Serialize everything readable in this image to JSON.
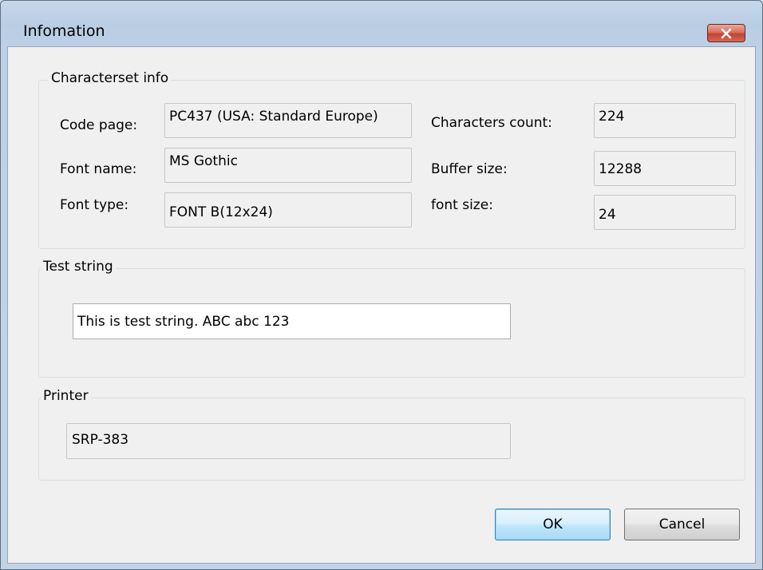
{
  "window": {
    "title": "Infomation",
    "close_icon": "close-x-icon"
  },
  "charset": {
    "legend": "Characterset info",
    "code_page_label": "Code page:",
    "code_page_value": "PC437 (USA: Standard Europe)",
    "font_name_label": "Font name:",
    "font_name_value": "MS Gothic",
    "font_type_label": "Font type:",
    "font_type_value": "FONT B(12x24)",
    "characters_count_label": "Characters count:",
    "characters_count_value": "224",
    "buffer_size_label": "Buffer size:",
    "buffer_size_value": "12288",
    "font_size_label": "font size:",
    "font_size_value": "24"
  },
  "test": {
    "legend": "Test string",
    "value": "This is test string. ABC abc 123"
  },
  "printer": {
    "legend": "Printer",
    "value": "SRP-383"
  },
  "buttons": {
    "ok": "OK",
    "cancel": "Cancel"
  },
  "colors": {
    "close_button": "#c4432f",
    "default_button_border": "#3c7fb1",
    "dialog_background": "#f0f0f0"
  }
}
